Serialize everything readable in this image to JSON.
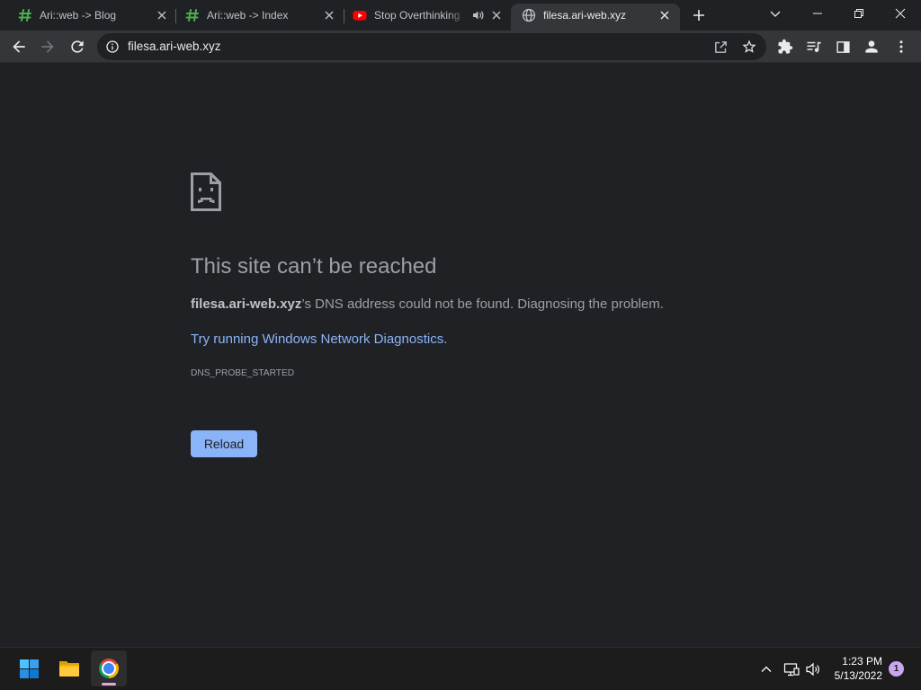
{
  "window": {
    "tabs": [
      {
        "title": "Ari::web -> Blog",
        "favicon": "hash-icon",
        "active": false
      },
      {
        "title": "Ari::web -> Index",
        "favicon": "hash-icon",
        "active": false
      },
      {
        "title": "Stop Overthinking",
        "favicon": "youtube-icon",
        "audio_icon": "speaker-icon",
        "active": false
      },
      {
        "title": "filesa.ari-web.xyz",
        "favicon": "globe-icon",
        "active": true
      }
    ],
    "new_tab_icon": "plus-icon",
    "controls": [
      "chevron-down-icon",
      "minimize-icon",
      "restore-icon",
      "close-icon"
    ]
  },
  "toolbar": {
    "url": "filesa.ari-web.xyz",
    "nav_icons": [
      "back-arrow-icon",
      "forward-arrow-icon",
      "reload-icon"
    ],
    "omnibox_icons": [
      "info-icon",
      "share-icon",
      "star-icon"
    ],
    "right_icons": [
      "puzzle-icon",
      "media-controls-icon",
      "side-panel-icon",
      "profile-icon",
      "more-vert-icon"
    ]
  },
  "error_page": {
    "icon": "sad-page-icon",
    "heading": "This site can’t be reached",
    "domain": "filesa.ari-web.xyz",
    "message": "’s DNS address could not be found. Diagnosing the problem.",
    "suggestion_link": "Try running Windows Network Diagnostics.",
    "error_code": "DNS_PROBE_STARTED",
    "reload_label": "Reload"
  },
  "taskbar": {
    "pinned_icons": [
      "windows-start-icon",
      "file-explorer-icon",
      "chrome-icon"
    ],
    "tray_icons": [
      "chevron-up-icon",
      "network-icon",
      "volume-icon"
    ],
    "time": "1:23 PM",
    "date": "5/13/2022",
    "notification_count": "1"
  },
  "colors": {
    "page_background": "#202124",
    "frame": "#202124",
    "toolbar": "#35363a",
    "omnibox": "#202124",
    "text_secondary": "#9aa0a6",
    "link": "#8ab4f8",
    "button": "#8ab4f8",
    "taskbar": "#1c1c1c",
    "taskbar_indicator": "#e3a7d9",
    "badge": "#c9a6ef"
  }
}
